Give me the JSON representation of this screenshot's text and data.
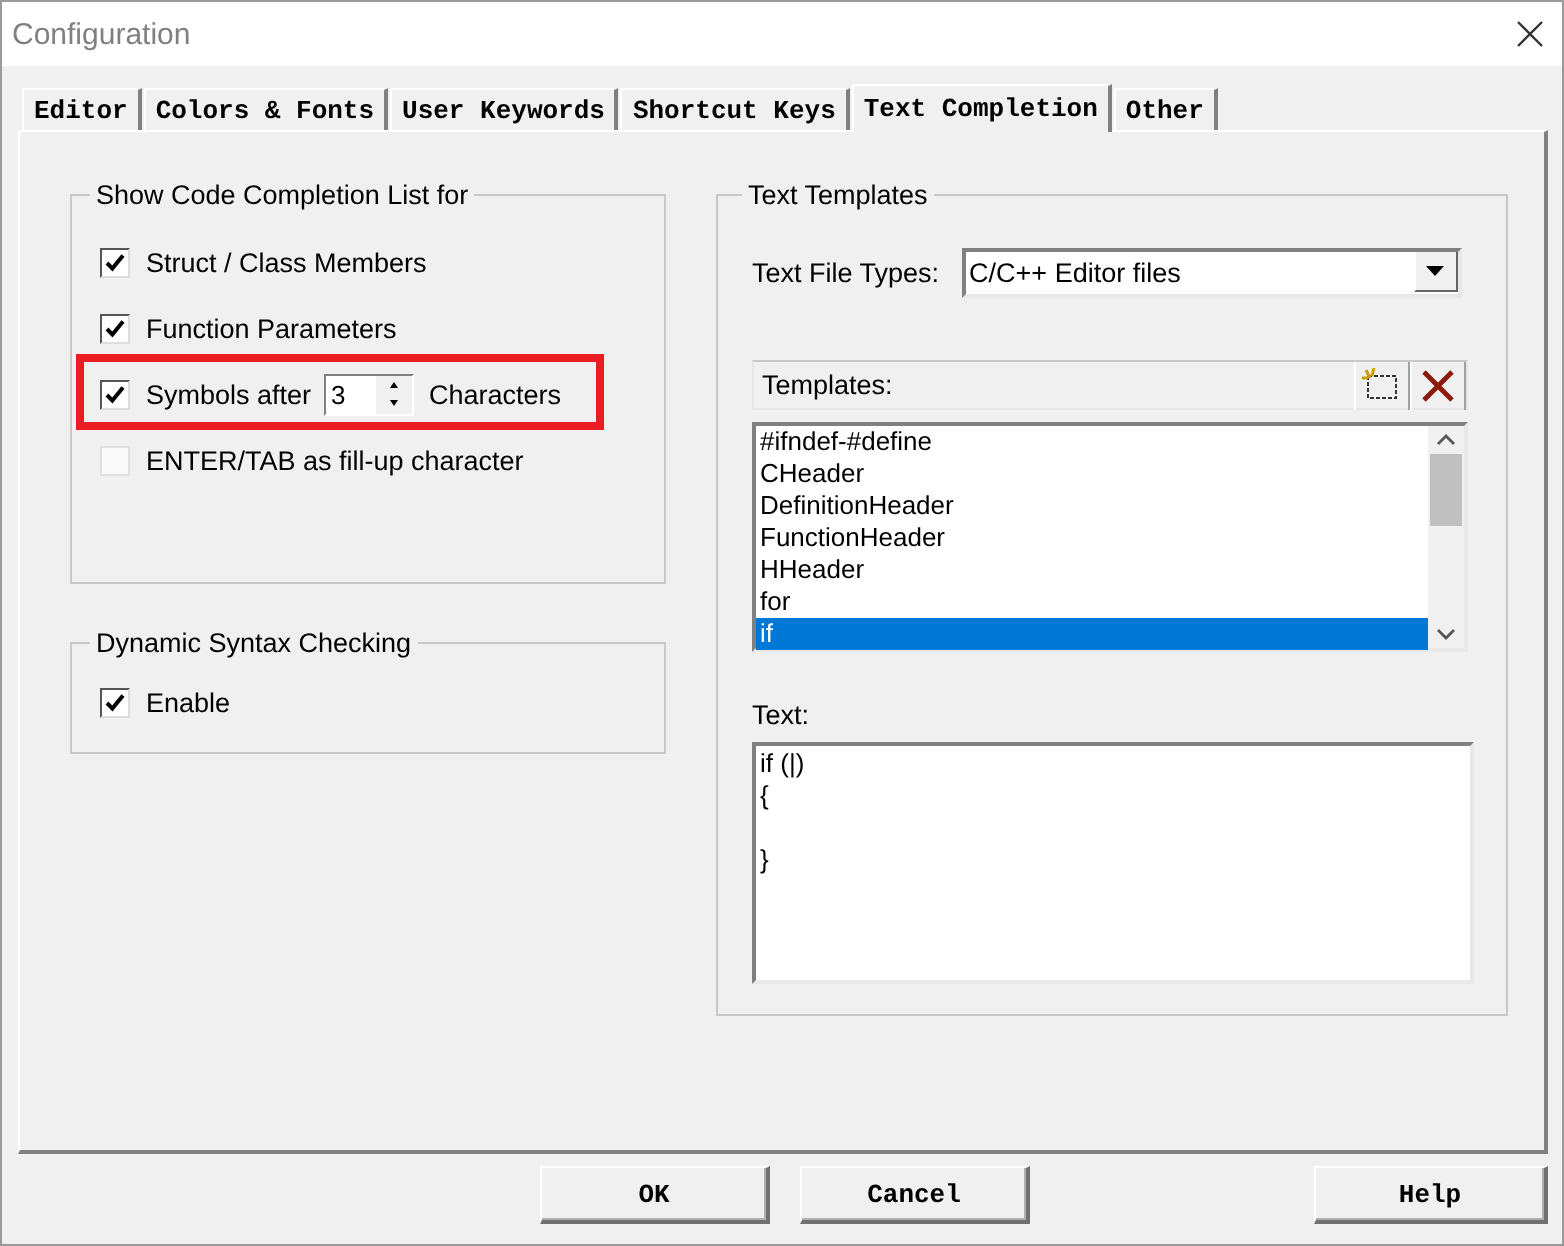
{
  "window": {
    "title": "Configuration"
  },
  "tabs": [
    {
      "label": "Editor",
      "selected": false
    },
    {
      "label": "Colors & Fonts",
      "selected": false
    },
    {
      "label": "User Keywords",
      "selected": false
    },
    {
      "label": "Shortcut Keys",
      "selected": false
    },
    {
      "label": "Text Completion",
      "selected": true
    },
    {
      "label": "Other",
      "selected": false
    }
  ],
  "completion_group": {
    "title": "Show Code Completion List for",
    "options": [
      {
        "kind": "checkbox",
        "label": "Struct / Class Members",
        "checked": true
      },
      {
        "kind": "checkbox",
        "label": "Function Parameters",
        "checked": true
      },
      {
        "kind": "spinner",
        "label": "Symbols after",
        "value": "3",
        "suffix": "Characters",
        "checked": true,
        "highlighted": true
      },
      {
        "kind": "checkbox",
        "label": "ENTER/TAB as fill-up character",
        "checked": false
      }
    ]
  },
  "syntax_group": {
    "title": "Dynamic Syntax Checking",
    "options": [
      {
        "label": "Enable",
        "checked": true
      }
    ]
  },
  "templates_group": {
    "title": "Text Templates",
    "file_types": {
      "label": "Text File Types:",
      "value": "C/C++ Editor files"
    },
    "templates": {
      "label": "Templates:",
      "items": [
        {
          "label": "#ifndef-#define",
          "selected": false
        },
        {
          "label": "CHeader",
          "selected": false
        },
        {
          "label": "DefinitionHeader",
          "selected": false
        },
        {
          "label": "FunctionHeader",
          "selected": false
        },
        {
          "label": "HHeader",
          "selected": false
        },
        {
          "label": "for",
          "selected": false
        },
        {
          "label": "if",
          "selected": true
        }
      ]
    },
    "text": {
      "label": "Text:",
      "value": "if (|)\n{\n\n}"
    }
  },
  "buttons": [
    {
      "label": "OK"
    },
    {
      "label": "Cancel"
    },
    {
      "label": "Help"
    }
  ]
}
